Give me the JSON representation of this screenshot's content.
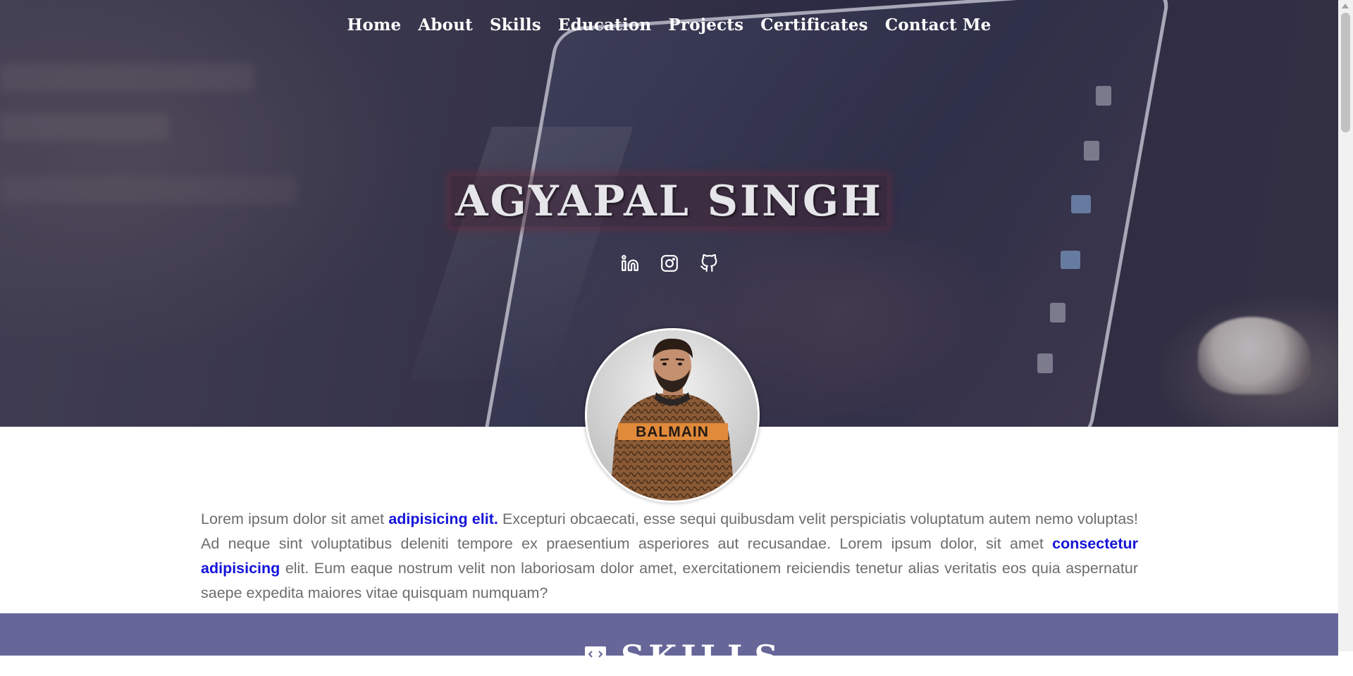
{
  "nav": {
    "items": [
      "Home",
      "About",
      "Skills",
      "Education",
      "Projects",
      "Certificates",
      "Contact Me"
    ]
  },
  "hero": {
    "name": "AGYAPAL SINGH",
    "socials": [
      "linkedin-icon",
      "instagram-icon",
      "github-icon"
    ]
  },
  "about": {
    "t1": "Lorem ipsum dolor sit amet ",
    "b1": "adipisicing elit.",
    "t2": " Excepturi obcaecati, esse sequi quibusdam velit perspiciatis voluptatum autem nemo voluptas! Ad neque sint voluptatibus deleniti tempore ex praesentium asperiores aut recusandae. Lorem ipsum dolor, sit amet ",
    "b2": "consectetur adipisicing",
    "t3": " elit. Eum eaque nostrum velit non laboriosam dolor amet, exercitationem reiciendis tenetur alias veritatis eos quia aspernatur saepe expedita maiores vitae quisquam numquam?"
  },
  "skills": {
    "title": "SKILLS",
    "icon": "laptop-code-icon"
  },
  "colors": {
    "accent_band": "#666699",
    "highlight": "#1414d8",
    "body_text": "#6d6d6d"
  }
}
